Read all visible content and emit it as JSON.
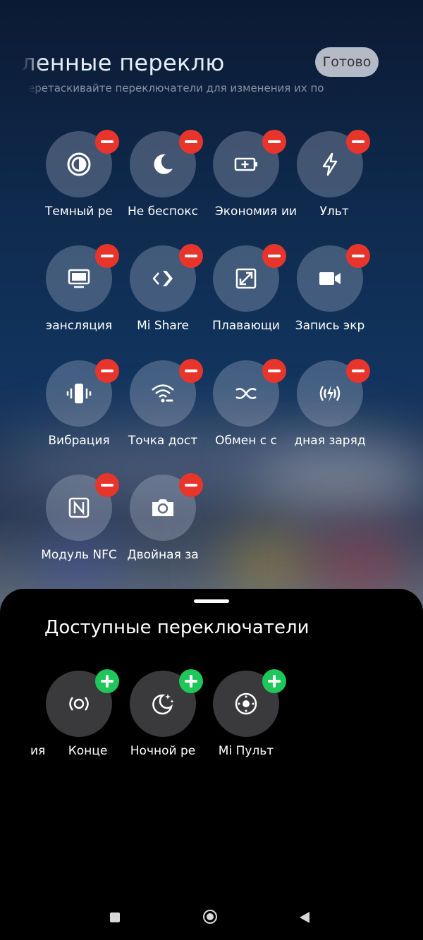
{
  "header": {
    "title": "ленные переклю",
    "subtitle": "еретаскивайте переключатели для изменения их по",
    "done_label": "Готово"
  },
  "added_toggles": [
    {
      "label": "Темный ре",
      "icon": "dark-mode-icon"
    },
    {
      "label": "Не беспокс",
      "icon": "moon-icon"
    },
    {
      "label": "Экономия",
      "icon": "battery-saver-icon"
    },
    {
      "label": "ии      Ульт",
      "icon": "lightning-icon"
    },
    {
      "label": "эансляция",
      "icon": "monitor-icon"
    },
    {
      "label": "Mi Share",
      "icon": "mi-share-icon"
    },
    {
      "label": "Плавающи",
      "icon": "floating-window-icon"
    },
    {
      "label": "Запись экр",
      "icon": "video-camera-icon"
    },
    {
      "label": "Вибрация",
      "icon": "vibration-icon"
    },
    {
      "label": "Точка дост",
      "icon": "hotspot-icon"
    },
    {
      "label": "Обмен с с",
      "icon": "exchange-icon"
    },
    {
      "label": "дная заряд",
      "icon": "wireless-charging-icon"
    },
    {
      "label": "Модуль NFC",
      "icon": "nfc-icon"
    },
    {
      "label": "Двойная за",
      "icon": "camera-rotate-icon"
    }
  ],
  "available": {
    "title": "Доступные переключатели",
    "toggles": [
      {
        "label": "ия      Конце",
        "icon": "broadcast-icon"
      },
      {
        "label": "Ночной ре",
        "icon": "night-mode-icon"
      },
      {
        "label": "Mi Пульт",
        "icon": "mi-remote-icon"
      }
    ]
  },
  "colors": {
    "remove_badge": "#e8352c",
    "add_badge": "#1fc75a",
    "sheet_bg": "#000000"
  }
}
